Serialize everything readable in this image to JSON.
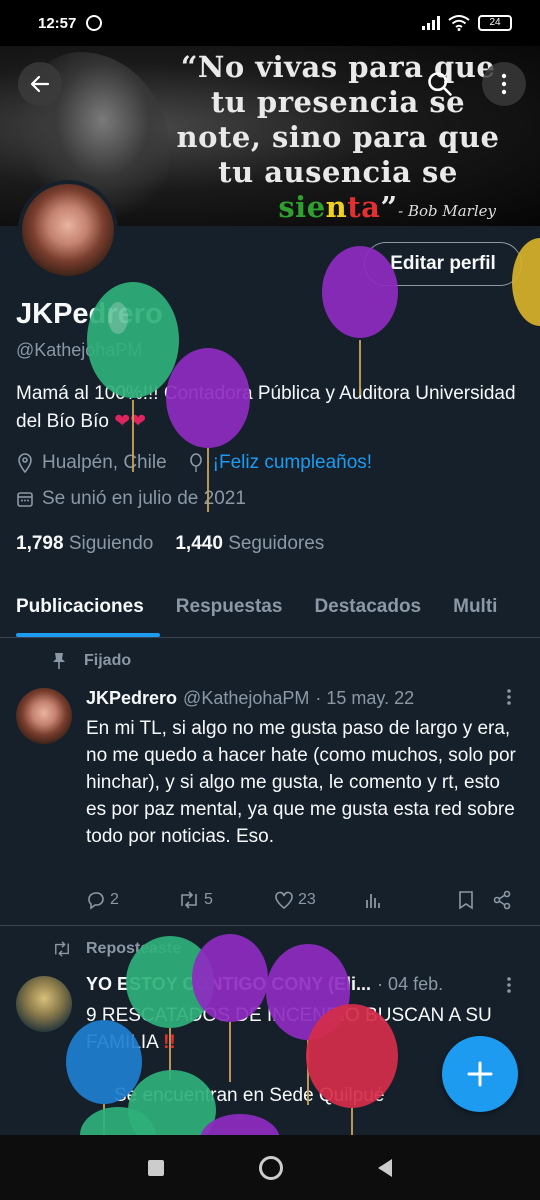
{
  "status_bar": {
    "time": "12:57",
    "battery": "24"
  },
  "banner": {
    "quote_lines": [
      "“No vivas para que",
      "tu presencia se",
      "note, sino para que",
      "tu ausencia se"
    ],
    "last_word_parts": [
      "sie",
      "n",
      "ta"
    ],
    "last_word_suffix": "”",
    "author": "- Bob Marley"
  },
  "header": {
    "edit_profile_label": "Editar perfil"
  },
  "profile": {
    "name": "JKPedrero",
    "handle": "@KathejohaPM",
    "bio": "Mamá al 100%!!! Contadora Pública y Auditora Universidad del Bío Bío",
    "bio_hearts": "❤❤",
    "location": "Hualpén, Chile",
    "birthday_link": "¡Feliz cumpleaños!",
    "joined": "Se unió en julio de 2021",
    "following_count": "1,798",
    "following_label": "Siguiendo",
    "followers_count": "1,440",
    "followers_label": "Seguidores"
  },
  "tabs": [
    {
      "label": "Publicaciones",
      "active": true
    },
    {
      "label": "Respuestas",
      "active": false
    },
    {
      "label": "Destacados",
      "active": false
    },
    {
      "label": "Multi",
      "active": false
    }
  ],
  "pinned_tweet": {
    "pinned_label": "Fijado",
    "author": "JKPedrero",
    "handle": "@KathejohaPM",
    "date": "· 15 may. 22",
    "text": "En mi TL, si algo no me gusta paso de largo y era, no me quedo a hacer hate (como muchos, solo por hinchar), y si algo me gusta, le comento y rt, esto es por paz mental, ya que me gusta esta red sobre todo por noticias. Eso.",
    "replies": "2",
    "reposts": "5",
    "likes": "23"
  },
  "reposted_tweet": {
    "repost_label": "Reposteaste",
    "author": "YO ESTOY CONTIGO CONY (Eli...",
    "date": "· 04 feb.",
    "text_line1": "9 RESCATADOS DE INCENDIO BUSCAN A SU",
    "text_line2": "FAMILIA",
    "text_line3": "Se encuentran en Sede Quilpué"
  },
  "icons": {
    "back": "arrow-left-icon",
    "search": "search-icon",
    "more": "more-vertical-icon",
    "location": "location-pin-icon",
    "balloon": "balloon-icon",
    "calendar": "calendar-icon",
    "pin": "pin-icon",
    "repost": "repost-icon",
    "reply": "reply-icon",
    "like": "heart-icon",
    "views": "bar-chart-icon",
    "bookmark": "bookmark-icon",
    "share": "share-icon",
    "compose": "plus-icon"
  },
  "colors": {
    "background": "#15202b",
    "accent": "#1d9bf0",
    "muted_text": "#8b98a5",
    "border": "#38444d"
  }
}
